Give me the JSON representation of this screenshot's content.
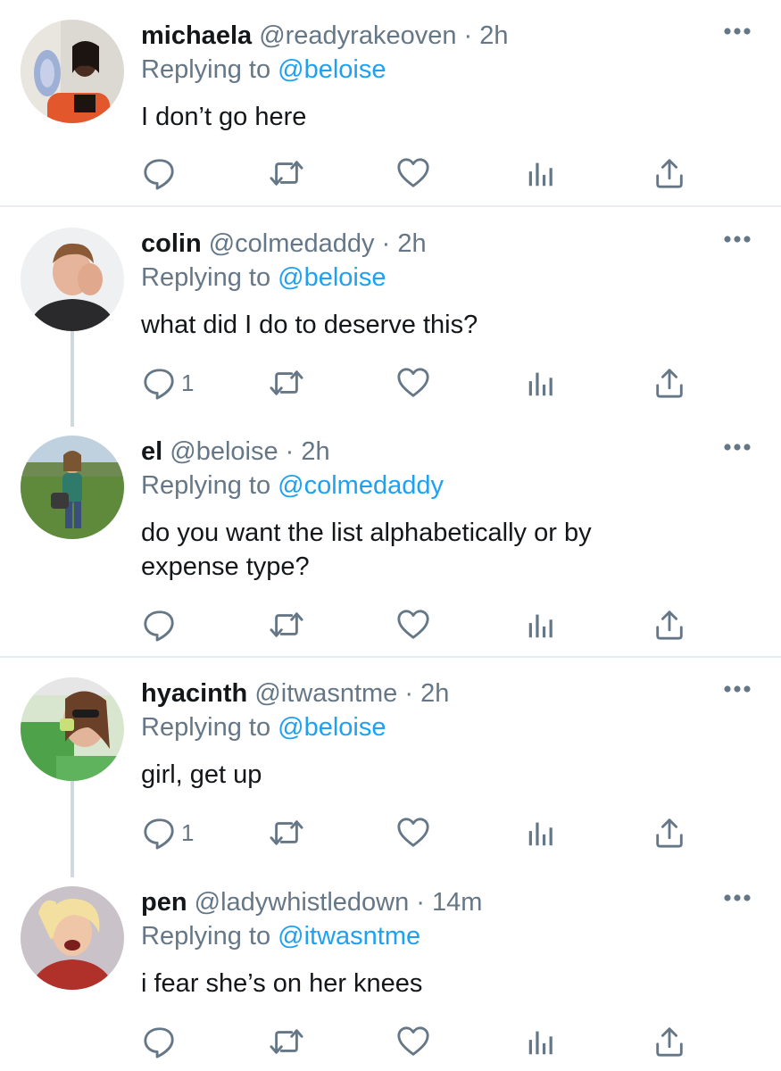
{
  "colors": {
    "text": "#14171a",
    "muted": "#657786",
    "mention": "#1da1f2",
    "divider": "#e6ecf0",
    "thread_line": "#cfd9de"
  },
  "icons": {
    "reply": "speech-bubble-outline",
    "retweet": "two-arrows-loop",
    "like": "heart-outline",
    "analytics": "bar-chart",
    "share": "upload-arrow",
    "more": "three-dots"
  },
  "replying_to_prefix": "Replying to",
  "tweets": [
    {
      "name": "michaela",
      "handle": "@readyrakeoven",
      "separator": "·",
      "time": "2h",
      "replying_to": "@beloise",
      "text": "I don’t go here",
      "reply_count": ""
    },
    {
      "name": "colin",
      "handle": "@colmedaddy",
      "separator": "·",
      "time": "2h",
      "replying_to": "@beloise",
      "text": "what did I do to deserve this?",
      "reply_count": "1"
    },
    {
      "name": "el",
      "handle": "@beloise",
      "separator": "·",
      "time": "2h",
      "replying_to": "@colmedaddy",
      "text": "do you want the list alphabetically or by expense type?",
      "reply_count": ""
    },
    {
      "name": "hyacinth",
      "handle": "@itwasntme",
      "separator": "·",
      "time": "2h",
      "replying_to": "@beloise",
      "text": "girl, get up",
      "reply_count": "1"
    },
    {
      "name": "pen",
      "handle": "@ladywhistledown",
      "separator": "·",
      "time": "14m",
      "replying_to": "@itwasntme",
      "text": "i fear she’s on her knees",
      "reply_count": ""
    }
  ]
}
